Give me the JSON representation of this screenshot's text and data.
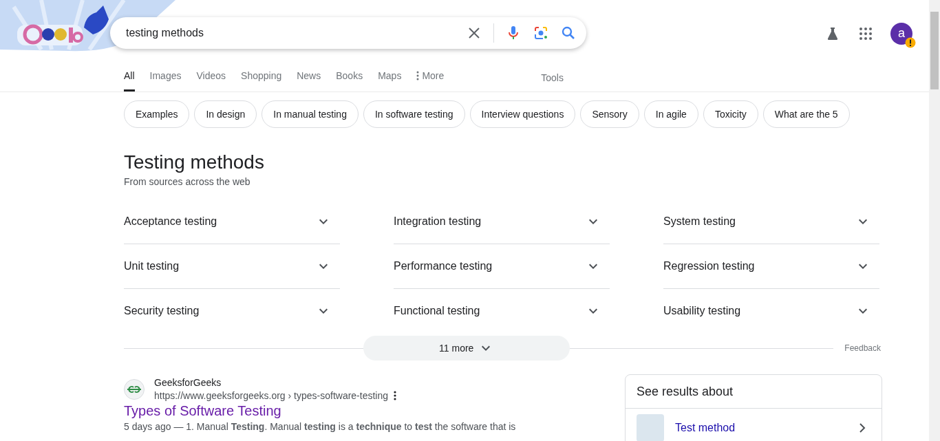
{
  "search": {
    "value": "testing methods"
  },
  "avatar": {
    "letter": "a"
  },
  "tabs": [
    {
      "label": "All",
      "selected": true,
      "kind": "tab"
    },
    {
      "label": "Images",
      "selected": false,
      "kind": "tab"
    },
    {
      "label": "Videos",
      "selected": false,
      "kind": "tab"
    },
    {
      "label": "Shopping",
      "selected": false,
      "kind": "tab"
    },
    {
      "label": "News",
      "selected": false,
      "kind": "tab"
    },
    {
      "label": "Books",
      "selected": false,
      "kind": "tab"
    },
    {
      "label": "Maps",
      "selected": false,
      "kind": "tab"
    },
    {
      "label": "More",
      "selected": false,
      "kind": "more"
    }
  ],
  "tools": "Tools",
  "chips": [
    "Examples",
    "In design",
    "In manual testing",
    "In software testing",
    "Interview questions",
    "Sensory",
    "In agile",
    "Toxicity",
    "What are the 5"
  ],
  "methods": {
    "title": "Testing methods",
    "subtitle": "From sources across the web",
    "items": [
      {
        "label": "Acceptance testing",
        "expanded": false
      },
      {
        "label": "Integration testing",
        "expanded": false
      },
      {
        "label": "System testing",
        "expanded": false
      },
      {
        "label": "Unit testing",
        "expanded": false
      },
      {
        "label": "Performance testing",
        "expanded": false
      },
      {
        "label": "Regression testing",
        "expanded": false
      },
      {
        "label": "Security testing",
        "expanded": false
      },
      {
        "label": "Functional testing",
        "expanded": false
      },
      {
        "label": "Usability testing",
        "expanded": false
      }
    ],
    "more": "11 more",
    "feedback": "Feedback"
  },
  "result": {
    "site": "GeeksforGeeks",
    "url": "https://www.geeksforgeeks.org › types-software-testing",
    "title": "Types of Software Testing",
    "snippet": "5 days ago — 1. Manual **Testing**. Manual **testing** is a **technique** to **test** the software that is"
  },
  "side_card": {
    "heading": "See results about",
    "items": [
      {
        "title": "Test method"
      }
    ]
  }
}
